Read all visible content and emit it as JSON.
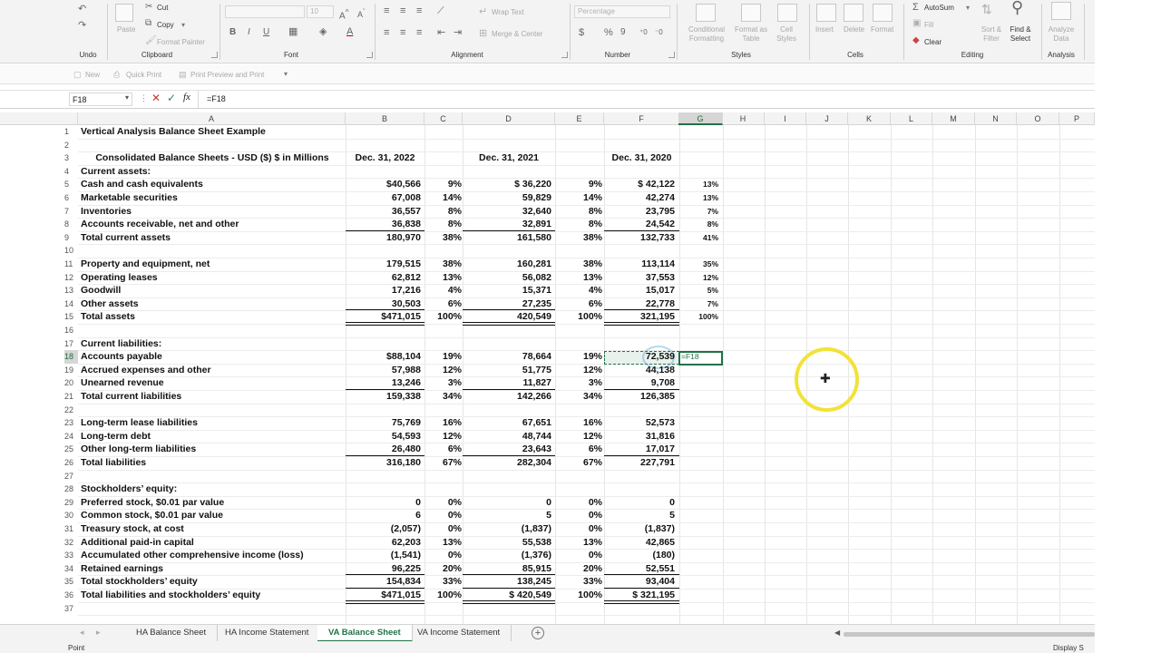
{
  "ribbon": {
    "clipboard": {
      "cut": "Cut",
      "copy": "Copy",
      "paste": "Paste",
      "format_painter": "Format Painter",
      "label": "Clipboard"
    },
    "undo_label": "Undo",
    "font_label": "Font",
    "font_size": "10",
    "alignment": {
      "wrap_text": "Wrap Text",
      "merge_center": "Merge & Center",
      "label": "Alignment"
    },
    "number": {
      "format": "Percentage",
      "label": "Number"
    },
    "styles": {
      "conditional": "Conditional Formatting",
      "format_as": "Format as Table",
      "cell_styles": "Cell Styles",
      "label": "Styles"
    },
    "cells": {
      "insert": "Insert",
      "delete": "Delete",
      "format": "Format",
      "label": "Cells"
    },
    "editing": {
      "autosum": "AutoSum",
      "fill": "Fill",
      "clear": "Clear",
      "sort": "Sort & Filter",
      "find": "Find & Select",
      "label": "Editing"
    },
    "analysis": {
      "analyze": "Analyze Data",
      "label": "Analysis"
    }
  },
  "qat": {
    "new": "New",
    "quick_print": "Quick Print",
    "print_preview": "Print Preview and Print"
  },
  "formula_bar": {
    "name_box": "F18",
    "formula": "=F18"
  },
  "columns": [
    "A",
    "B",
    "C",
    "D",
    "E",
    "F",
    "G",
    "H",
    "I",
    "J",
    "K",
    "L",
    "M",
    "N",
    "O",
    "P"
  ],
  "selected_column": "G",
  "selected_row": "18",
  "rows": [
    "1",
    "2",
    "3",
    "4",
    "5",
    "6",
    "7",
    "8",
    "9",
    "10",
    "11",
    "12",
    "13",
    "14",
    "15",
    "16",
    "17",
    "18",
    "19",
    "20",
    "21",
    "22",
    "23",
    "24",
    "25",
    "26",
    "27",
    "28",
    "29",
    "30",
    "31",
    "32",
    "33",
    "34",
    "35",
    "36",
    "37"
  ],
  "sheet": {
    "title": "Vertical Analysis Balance Sheet Example",
    "header_label": "Consolidated Balance Sheets - USD ($) $ in Millions",
    "col_b": "Dec. 31, 2022",
    "col_d": "Dec. 31, 2021",
    "col_f": "Dec. 31, 2020",
    "lines": [
      {
        "row": 4,
        "label": "Current assets:"
      },
      {
        "row": 5,
        "label": "Cash and cash equivalents",
        "b": "$40,566",
        "c": "9%",
        "d": "$ 36,220",
        "e": "9%",
        "f": "$ 42,122",
        "g": "13%"
      },
      {
        "row": 6,
        "label": "Marketable securities",
        "b": "67,008",
        "c": "14%",
        "d": "59,829",
        "e": "14%",
        "f": "42,274",
        "g": "13%"
      },
      {
        "row": 7,
        "label": "Inventories",
        "b": "36,557",
        "c": "8%",
        "d": "32,640",
        "e": "8%",
        "f": "23,795",
        "g": "7%"
      },
      {
        "row": 8,
        "label": "Accounts receivable, net and other",
        "b": "36,838",
        "c": "8%",
        "d": "32,891",
        "e": "8%",
        "f": "24,542",
        "g": "8%"
      },
      {
        "row": 9,
        "label": "Total current assets",
        "b": "180,970",
        "c": "38%",
        "d": "161,580",
        "e": "38%",
        "f": "132,733",
        "g": "41%"
      },
      {
        "row": 11,
        "label": "Property and equipment, net",
        "b": "179,515",
        "c": "38%",
        "d": "160,281",
        "e": "38%",
        "f": "113,114",
        "g": "35%"
      },
      {
        "row": 12,
        "label": "Operating leases",
        "b": "62,812",
        "c": "13%",
        "d": "56,082",
        "e": "13%",
        "f": "37,553",
        "g": "12%"
      },
      {
        "row": 13,
        "label": "Goodwill",
        "b": "17,216",
        "c": "4%",
        "d": "15,371",
        "e": "4%",
        "f": "15,017",
        "g": "5%"
      },
      {
        "row": 14,
        "label": "Other assets",
        "b": "30,503",
        "c": "6%",
        "d": "27,235",
        "e": "6%",
        "f": "22,778",
        "g": "7%"
      },
      {
        "row": 15,
        "label": "Total assets",
        "b": "$471,015",
        "c": "100%",
        "d": "420,549",
        "e": "100%",
        "f": "321,195",
        "g": "100%"
      },
      {
        "row": 17,
        "label": "Current liabilities:"
      },
      {
        "row": 18,
        "label": "Accounts payable",
        "b": "$88,104",
        "c": "19%",
        "d": "78,664",
        "e": "19%",
        "f": "72,539",
        "g": "=F18"
      },
      {
        "row": 19,
        "label": "Accrued expenses and other",
        "b": "57,988",
        "c": "12%",
        "d": "51,775",
        "e": "12%",
        "f": "44,138"
      },
      {
        "row": 20,
        "label": "Unearned revenue",
        "b": "13,246",
        "c": "3%",
        "d": "11,827",
        "e": "3%",
        "f": "9,708"
      },
      {
        "row": 21,
        "label": "Total current liabilities",
        "b": "159,338",
        "c": "34%",
        "d": "142,266",
        "e": "34%",
        "f": "126,385"
      },
      {
        "row": 23,
        "label": "Long-term lease liabilities",
        "b": "75,769",
        "c": "16%",
        "d": "67,651",
        "e": "16%",
        "f": "52,573"
      },
      {
        "row": 24,
        "label": "Long-term debt",
        "b": "54,593",
        "c": "12%",
        "d": "48,744",
        "e": "12%",
        "f": "31,816"
      },
      {
        "row": 25,
        "label": "Other long-term liabilities",
        "b": "26,480",
        "c": "6%",
        "d": "23,643",
        "e": "6%",
        "f": "17,017"
      },
      {
        "row": 26,
        "label": "Total liabilities",
        "b": "316,180",
        "c": "67%",
        "d": "282,304",
        "e": "67%",
        "f": "227,791"
      },
      {
        "row": 28,
        "label": "Stockholders’ equity:"
      },
      {
        "row": 29,
        "label": "Preferred stock, $0.01 par value",
        "b": "0",
        "c": "0%",
        "d": "0",
        "e": "0%",
        "f": "0"
      },
      {
        "row": 30,
        "label": "Common stock, $0.01 par value",
        "b": "6",
        "c": "0%",
        "d": "5",
        "e": "0%",
        "f": "5"
      },
      {
        "row": 31,
        "label": "Treasury stock, at cost",
        "b": "(2,057)",
        "c": "0%",
        "d": "(1,837)",
        "e": "0%",
        "f": "(1,837)"
      },
      {
        "row": 32,
        "label": "Additional paid-in capital",
        "b": "62,203",
        "c": "13%",
        "d": "55,538",
        "e": "13%",
        "f": "42,865"
      },
      {
        "row": 33,
        "label": "Accumulated other comprehensive income (loss)",
        "b": "(1,541)",
        "c": "0%",
        "d": "(1,376)",
        "e": "0%",
        "f": "(180)"
      },
      {
        "row": 34,
        "label": "Retained earnings",
        "b": "96,225",
        "c": "20%",
        "d": "85,915",
        "e": "20%",
        "f": "52,551"
      },
      {
        "row": 35,
        "label": "Total stockholders’ equity",
        "b": "154,834",
        "c": "33%",
        "d": "138,245",
        "e": "33%",
        "f": "93,404"
      },
      {
        "row": 36,
        "label": "Total liabilities and stockholders’ equity",
        "b": "$471,015",
        "c": "100%",
        "d": "$ 420,549",
        "e": "100%",
        "f": "$ 321,195"
      }
    ]
  },
  "tabs": [
    "HA Balance Sheet",
    "HA Income Statement",
    "VA Balance Sheet",
    "VA Income Statement"
  ],
  "active_tab": "VA Balance Sheet",
  "status": {
    "mode": "Point",
    "display": "Display S"
  },
  "colors": {
    "accent": "#217346",
    "cursor_ring": "#f2e23a"
  }
}
